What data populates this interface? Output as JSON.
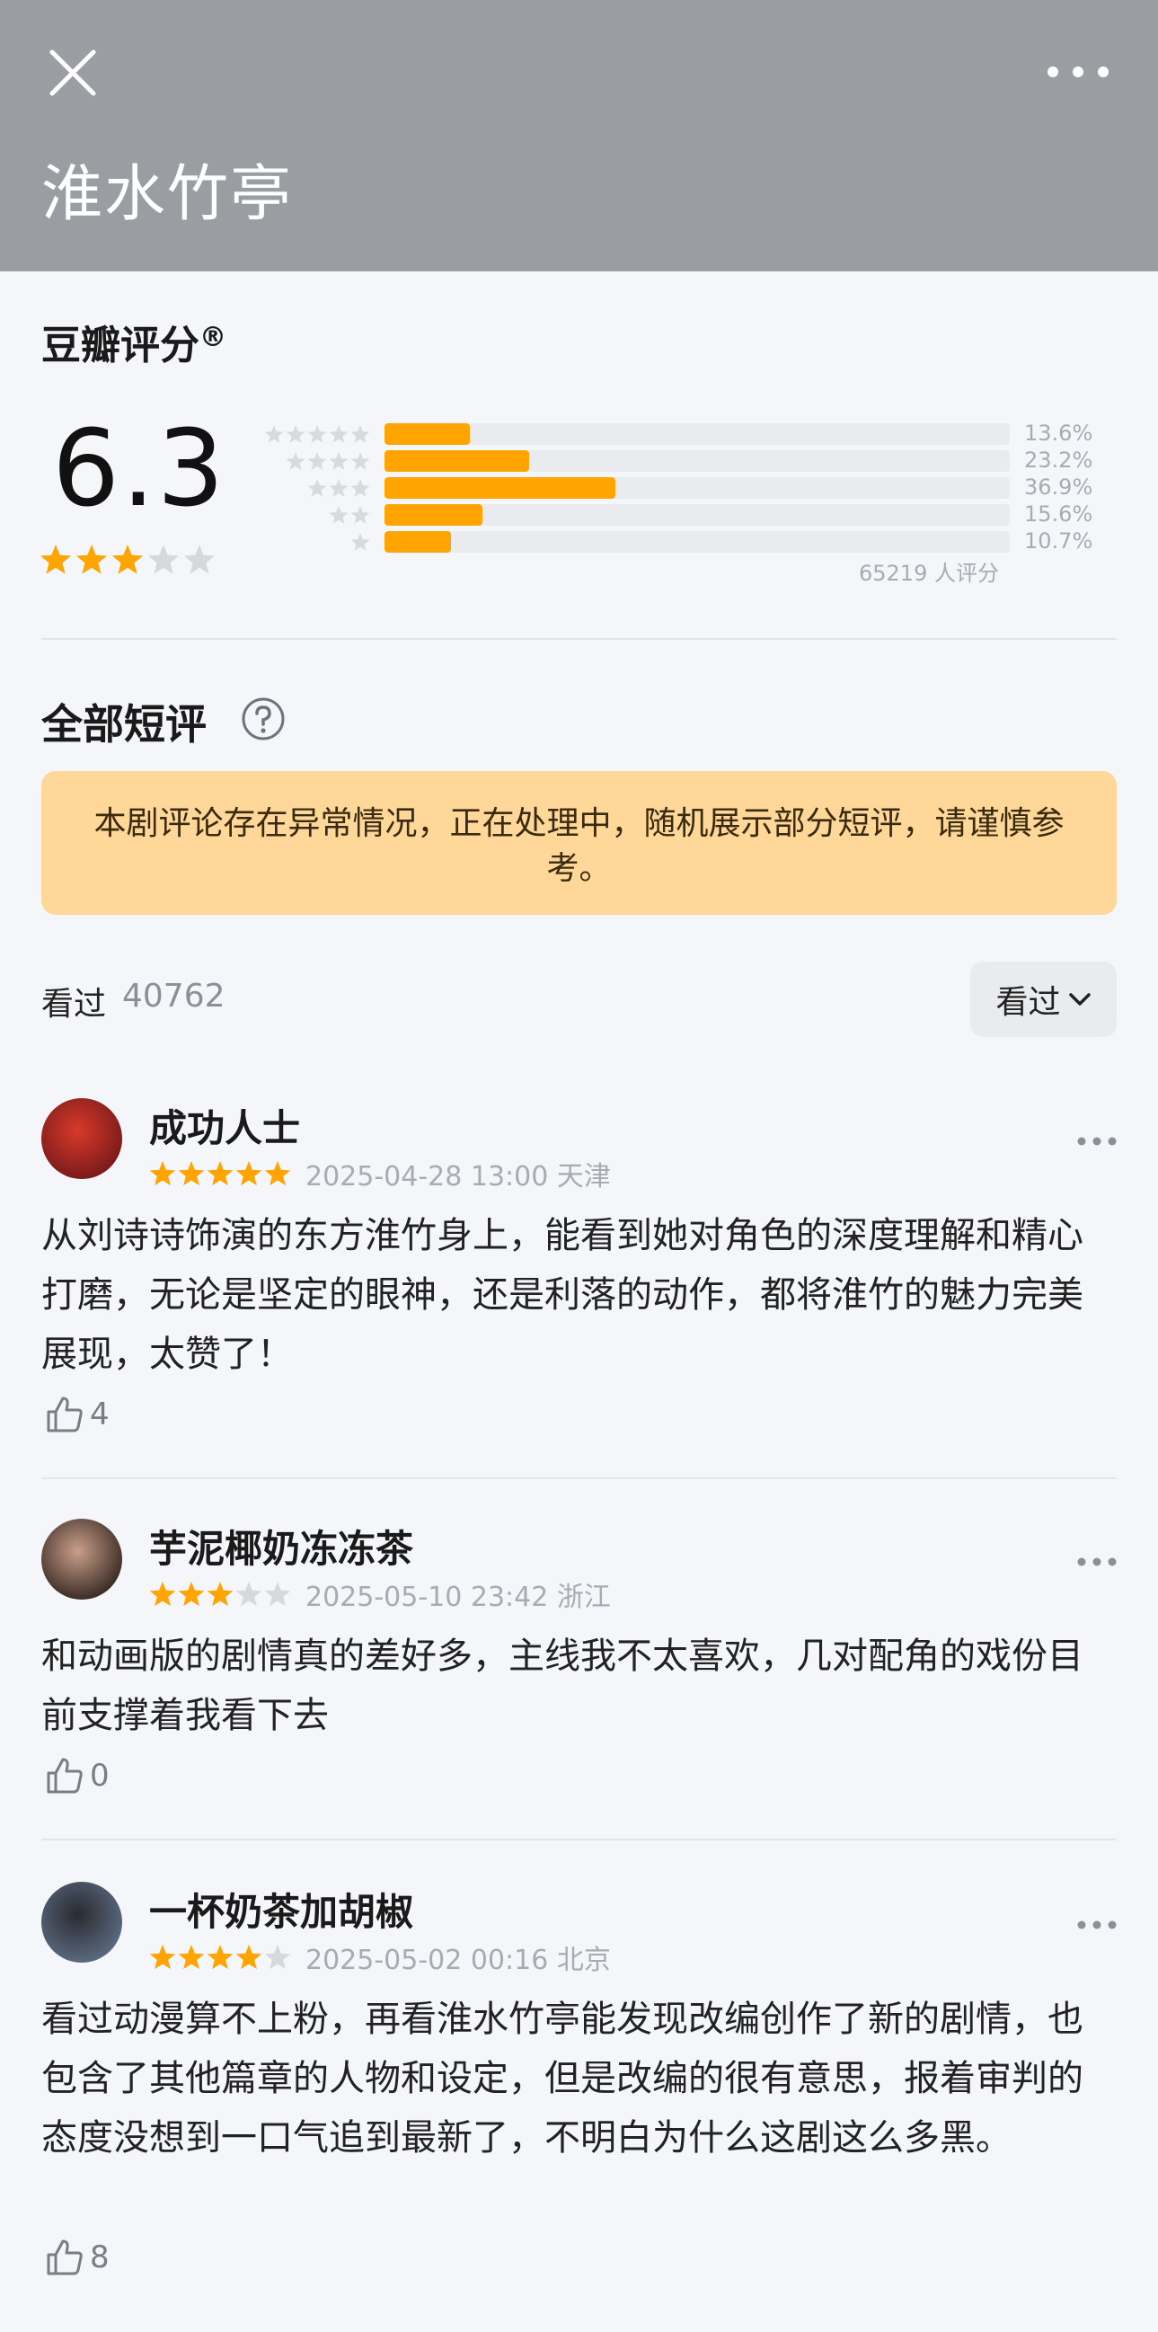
{
  "header": {
    "title": "淮水竹亭",
    "close_icon": "close-icon",
    "more_icon": "more-horizontal-icon"
  },
  "rating": {
    "title": "豆瓣评分",
    "registered_mark": "®",
    "score": "6.3",
    "stars_filled": 3,
    "distribution": [
      {
        "stars": 5,
        "percent_label": "13.6%",
        "percent": 13.6
      },
      {
        "stars": 4,
        "percent_label": "23.2%",
        "percent": 23.2
      },
      {
        "stars": 3,
        "percent_label": "36.9%",
        "percent": 36.9
      },
      {
        "stars": 2,
        "percent_label": "15.6%",
        "percent": 15.6
      },
      {
        "stars": 1,
        "percent_label": "10.7%",
        "percent": 10.7
      }
    ],
    "votes": "65219 人评分"
  },
  "reviews_section": {
    "title": "全部短评",
    "help_icon": "question-circle-icon",
    "notice": "本剧评论存在异常情况，正在处理中，随机展示部分短评，请谨慎参考。",
    "watched_label": "看过",
    "watched_count": "40762",
    "filter_label": "看过",
    "filter_icon": "chevron-down-icon"
  },
  "reviews": [
    {
      "username": "成功人士",
      "stars": 5,
      "date": "2025-04-28 13:00 天津",
      "text": "从刘诗诗饰演的东方淮竹身上，能看到她对角色的深度理解和精心打磨，无论是坚定的眼神，还是利落的动作，都将淮竹的魅力完美展现，太赞了！",
      "likes": "4"
    },
    {
      "username": "芋泥椰奶冻冻茶",
      "stars": 3,
      "date": "2025-05-10 23:42 浙江",
      "text": "和动画版的剧情真的差好多，主线我不太喜欢，几对配角的戏份目前支撑着我看下去",
      "likes": "0"
    },
    {
      "username": "一杯奶茶加胡椒",
      "stars": 4,
      "date": "2025-05-02 00:16 北京",
      "text": "看过动漫算不上粉，再看淮水竹亭能发现改编创作了新的剧情，也包含了其他篇章的人物和设定，但是改编的很有意思，报着审判的态度没想到一口气追到最新了，不明白为什么这剧这么多黑。",
      "likes": "8"
    }
  ],
  "colors": {
    "header_bg": "#9a9da2",
    "star_orange": "#ffa400",
    "star_gray": "#d6d8dc",
    "notice_bg": "#ffd899",
    "page_bg": "#f4f6f9"
  }
}
